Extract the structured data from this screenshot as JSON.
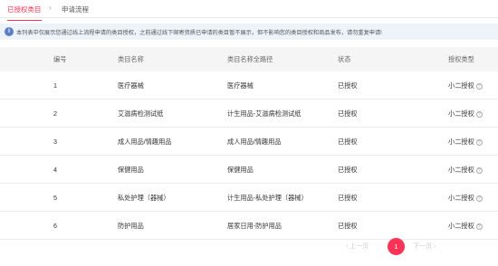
{
  "tabs": {
    "active_label": "已授权类目",
    "separator": "›",
    "second_label": "申请流程"
  },
  "notice": {
    "icon": "info-icon",
    "text": "本列表中仅展示您通过线上流程申请的类目授权，之前通过线下邮寄资质已申请的类目暂不展示，但不影响您的类目授权和商品发布，请勿重复申请!"
  },
  "table": {
    "headers": {
      "index": "编号",
      "name": "类目名称",
      "full_path": "类目名称全路径",
      "status": "状态",
      "auth_type": "授权类型"
    },
    "rows": [
      {
        "index": "1",
        "name": "医疗器械",
        "full_path": "医疗器械",
        "status": "已授权",
        "auth_type": "小二授权"
      },
      {
        "index": "2",
        "name": "艾滋病检测试纸",
        "full_path": "计生用品-艾滋病检测试纸",
        "status": "已授权",
        "auth_type": "小二授权"
      },
      {
        "index": "3",
        "name": "成人用品/情趣用品",
        "full_path": "成人用品/情趣用品",
        "status": "已授权",
        "auth_type": "小二授权"
      },
      {
        "index": "4",
        "name": "保健用品",
        "full_path": "保健用品",
        "status": "已授权",
        "auth_type": "小二授权"
      },
      {
        "index": "5",
        "name": "私处护理（器械）",
        "full_path": "计生用品-私处护理（器械）",
        "status": "已授权",
        "auth_type": "小二授权"
      },
      {
        "index": "6",
        "name": "防护用品",
        "full_path": "居家日用-防护用品",
        "status": "已授权",
        "auth_type": "小二授权"
      }
    ]
  },
  "pagination": {
    "prev_label": "‹ 上一页",
    "current_page": "1",
    "next_label": "下一页 ›"
  },
  "colors": {
    "accent": "#ff3355",
    "notice_bg": "#eef2f9",
    "header_bg": "#f5f5f5"
  }
}
